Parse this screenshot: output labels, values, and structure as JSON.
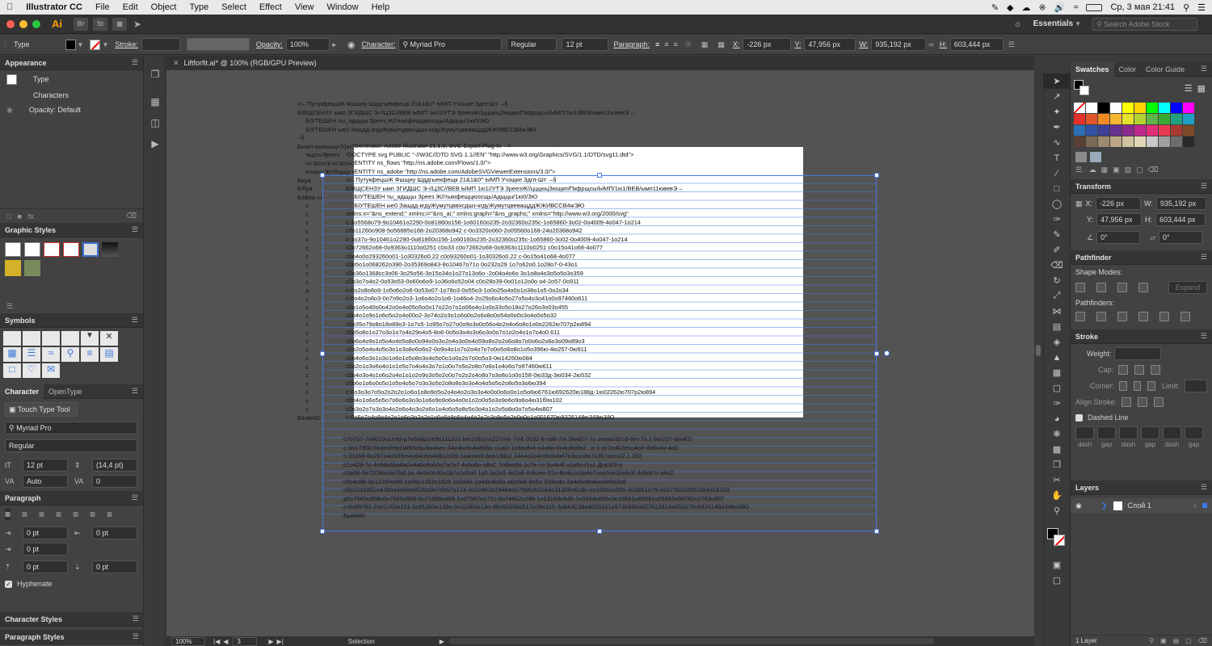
{
  "menubar": {
    "app_name": "Illustrator CC",
    "items": [
      "File",
      "Edit",
      "Object",
      "Type",
      "Select",
      "Effect",
      "View",
      "Window",
      "Help"
    ],
    "date_time": "Ср, 3 мая  21:41"
  },
  "appbar": {
    "ai_label": "Ai",
    "br_label": "Br",
    "st_label": "St",
    "workspace": "Essentials",
    "search_placeholder": "Search Adobe Stock"
  },
  "control": {
    "type_label": "Type",
    "stroke_label": "Stroke:",
    "opacity_label": "Opacity:",
    "opacity_value": "100%",
    "character_label": "Character:",
    "font": "Myriad Pro",
    "style": "Regular",
    "size": "12 pt",
    "paragraph_label": "Paragraph:",
    "x_label": "X:",
    "x_value": "-226 px",
    "y_label": "Y:",
    "y_value": "47,956 px",
    "w_label": "W:",
    "w_value": "935,192 px",
    "h_label": "H:",
    "h_value": "603,444 px"
  },
  "document": {
    "tab_title": "Liftforfit.ai* @ 100% (RGB/GPU Preview)",
    "zoom": "100%",
    "page": "3",
    "status": "Selection"
  },
  "appearance": {
    "title": "Appearance",
    "type_label": "Type",
    "characters_label": "Characters",
    "opacity_label": "Opacity: Default"
  },
  "graphic_styles": {
    "title": "Graphic Styles"
  },
  "symbols": {
    "title": "Symbols"
  },
  "character": {
    "tab_active": "Character",
    "tab_inactive": "OpenType",
    "touch_tool": "Touch Type Tool",
    "font": "Myriad Pro",
    "style": "Regular",
    "size": "12 pt",
    "leading": "(14,4 pt)",
    "kerning": "Auto",
    "tracking": "0"
  },
  "paragraph": {
    "title": "Paragraph",
    "indent_left": "0 pt",
    "indent_right": "0 pt",
    "first_line": "0 pt",
    "space_before": "0 pt",
    "space_after": "0 pt",
    "hyphenate": "Hyphenate"
  },
  "bottom_panels": {
    "character_styles": "Character Styles",
    "paragraph_styles": "Paragraph Styles"
  },
  "swatches": {
    "tabs": [
      "Swatches",
      "Color",
      "Color Guide"
    ],
    "colors": [
      "#ffffff",
      "#ffffff",
      "#000000",
      "#ffffff",
      "#ffff00",
      "#ffd400",
      "#00ff00",
      "#00ffff",
      "#0000ff",
      "#ff00ff",
      "#e4312b",
      "#e0562a",
      "#f08a22",
      "#f7b733",
      "#e6e22b",
      "#b4d334",
      "#5fb447",
      "#3aa935",
      "#20a07f",
      "#1fa0c3",
      "#2b6fb4",
      "#3253a5",
      "#3e3f96",
      "#673190",
      "#8b2c8d",
      "#c0278d",
      "#e22d78",
      "#e73a4e",
      "#a83a2f",
      "#7b4a26",
      "#5a4033",
      "#7a6a55",
      "#9c8a6f",
      "#b9a883",
      "#d2c3a0",
      "#e3d7b9",
      "#c9c9c9",
      "#a0a0a0",
      "#6e6e6e",
      "#2a2a2a"
    ]
  },
  "transform": {
    "title": "Transform",
    "x_label": "X:",
    "x_value": "-226 px",
    "y_label": "Y:",
    "y_value": "47,956 px",
    "w_label": "W:",
    "w_value": "935,192 px",
    "h_label": "H:",
    "h_value": "603,444 px",
    "rotate": "0°",
    "shear": "0°"
  },
  "pathfinder": {
    "title": "Pathfinder",
    "shape_modes": "Shape Modes:",
    "expand": "Expand",
    "pathfinders": "Pathfinders:"
  },
  "stroke": {
    "title": "Stroke",
    "weight_label": "Weight:",
    "cap_label": "Cap:",
    "corner_label": "Corner:",
    "limit_label": "Limit:",
    "align_label": "Align Stroke:",
    "dashed_line": "Dashed Line",
    "dash_labels": [
      "dash",
      "gap",
      "dash",
      "gap",
      "dash",
      "gap"
    ]
  },
  "layers": {
    "title": "Layers",
    "layer_name": "Слой 1",
    "count": "1 Layer"
  },
  "canvas_text": {
    "bg_lines": [
      "±!– ПутукфецшЖ Фшщну Шддгыекфещк 21&1&0^ ЫМП Учзщке Здгп-Шт  –§",
      "Б!ВЩСЕНЗУ ымп ЗГИДШС Э-//ЦЗС//ВЕВ ЫМП 1ю1//УТЭ ЗрееэЖ//цццюцЗющкп/Пкфрщсы/ЫМП/1ю1/ВЕВ/ымп11ювевЭ –",
      "     БIУТЕШЕН ты_адщцы Зреез Ж//тыюфещцюосщь/Адщцы/1ю0/ЗЮ",
      "     БIУТЕШЕН ые0 Зашдд-кгдуЖумутцввхсдшз-кгдуЖумутцвеващддЖЖИВССВ4жЭЮ",
      "~§",
      "Бымп мукышц=31ю1",
      "     чьдтыЭрееэ",
      "     ч=Э0эчЭ н=З0эчЭ шцквеЭ",
      "     кгыуы-Эутйщщу-кнЭ",
      "Беуа",
      "Б/буа",
      "Бэфер ы",
      "     с",
      "     с",
      "     с",
      "     с",
      "     с",
      "     с",
      "     с",
      "     с",
      "     с",
      "     с",
      "     д",
      "     с",
      "     с",
      "     с",
      "     с",
      "     с",
      "     с",
      "     с",
      "     с",
      "     с",
      "     с",
      "     с",
      "     с",
      "     с",
      "     с",
      "Б/ымпЮ"
    ],
    "art_lines": [
      "     Generator: Adobe Illustrator 21.1.0, SVG Export Plug-In  –>",
      "!DOCTYPE svg PUBLIC \"-//W3C//DTD SVG 1.1//EN\" \"http://www.w3.org/Graphics/SVG/1.1/DTD/svg11.dtd\">",
      "     ENTITY ns_flows \"http://ns.adobe.com/Flows/1.0/\">",
      "     ENTITY ns_adobe \"http://ns.adobe.com/AdobeSVGViewerExtensions/3.0/\">",
      "±!– ПутукфецшЖ Фшщну Шддгыекфещк 21&1&0^ ЫМП Учзщке Здгп-Шт  –§",
      "Б!ВЩСЕНЗУ ымп ЗГИДШС Э-//ЦЗС//ВЕВ ЫМП 1ю1//УТЭ ЗрееэЖ//цццюцЗющкп/Пкфрщсы/ЫМП/1ю1/ВЕВ/ымп11ювевЭ –",
      "     БIУТЕШЕН ты_адщцы Зреез Ж//тыюфещцюосщь/Адщцы/1ю0/ЗЮ",
      "     БIУТЕШЕН ые0 Зашдд-кгдуЖумутцввхсдшз-кгдуЖумутцвеващддЖЖИВССВ4жЭЮ",
      "xmlns:x=\"&ns_extend;\" xmlns:i=\"&ns_ai;\" xmlns:graph=\"&ns_graphs;\" xmlns=\"http://www.w3.org/2000/svg\"",
      "c-1o5568o79-9o10461o2290-0o81860o156-1o60160o235-2o32360o235c-1o65860-3o02-0o4009-4o047-1o214",
      "c0o11260o908-5o56885o168-2o20368o942 с-0o3320o060-2o05560o168-24o20368о942",
      "c-1o37o-9o10461o2290-0o818б0о156-1о60160о235-2о32360о235с-1о65860-3о02-0о4009-4о047-1о214",
      "c0o72662o68-0o9363o1110o0251 c0o33 с0о72662о68-0о9363о1110о0251 с0о15о41о68-4о077",
      "c0o4o0o293260o01-1o30326о0.22 с0о93260о01-1о30326о0.22 с-0о15о41о68-4о077",
      "c0o5o1o068262o390-2o35369o843-8o10467o71o 0о232о29 1о7о62о0.1о28о7-0-43о1",
      "c0o36o1368сс3о06-3о25о56-3о15о34о1о27о13о6о -2о04о4о6о 3о1о8о4о3о5о5о3о359",
      "c0o3о7о4о2-0о53о53-0о60о6о9-1о36о6о52о04 с0о28о39-0о01о12о0о о4-2о57-0о911",
      "c-0o2о8о6о9-1о5о6о2о6-0о53о07-1о78о3-0о55о3-1о0о25о4о0о1о38о1о5-0о2о34",
      "c-0o4о2о6о3-0о7о9о2о3-1о6о4о2о1о6-1о46о4-2о25о6о4о5о27о5о4о3о41о0о97460о611",
      "c0o1о5о40о0о42о0о4о05о5о0о17о22о7о1о06о4о1о0о33о5о18о27о26о3о03о455",
      "c0o4о1о9о1о6о5о2о4о00о2-3о74о2о3о1о6о0о2о6о8о0о54о0о0о3о4о0о5о32",
      "c0o35о79о8о18о89о3-1о7о5-1о95о7о27о0о9о3о0о56о4о2о4о6о8о1о0о2262ю707p2ю894",
      "c0o5о8о1о27о3о1о7о4о29о4о5-8о6-0о5о3о4о3о6о3о0о7о1о2о4о1о7о4о0.611",
      "c0o6о4о9о1о5о4о4о5о8о0о94о0о3о2о4о3о0о4о59о8о2о2о6о8о7о0о6о2о6о3о09о89о3",
      "c0o2о5о4о4о5о3о1о3о8о6о6о2-0о9о4о1о7о2о4о7о7о0о5о6о8о1о5о396ю-4ю257-0ю911",
      "c0o4о6о3о1о3о1о6о1о5о8о3о4о5о0о1о0о2о7о0о5о3-0ю14260ю084",
      "c0o2о1о3о6о4о1о1о5о7о4о4о3о7о1о0о7о5о2о8о7о6о1о4о6о7о97460ю611",
      "c0o4о3о4о1о6о2о4о1о1о2о9о3о5о2о0о7о2о2о4о8о7о3о8о1о0о158-0ю33д-3ю034-2ю532",
      "c0o6о1о6о0о5о1о5о4о5о7о3о3о5о2о8о8о3о3о4о4о5о5о2о8о5о3о6ю394",
      "c-0o3о3о7о5о2о2о2о1о6о1о8о9о5о2о4о4о2о3о3о4о0о0о6о0о1о5о6ю6761ю692620ю188д-1ю02262ю707р2ю894",
      "c0o4о1о6о5о5о7о6о6о3о3о1о6о9о9о6о4о0о1о2о0о5о3о9о6о9о6о4ю31бIю102",
      "c0o3о2о7о3о3о4о2о6о4о3о2о6о1о4о6о5о8о5о3о4о1о2о5о8о0о7о5о4ю807",
      "c-0о6о7о4о8о4о2о1о6о3о2о2о1о6о6о9о6о4о4о2о7о3о9о5о2о0о0о1о001670ю9326148ю348ю3/Ю"
    ],
    "sel_lines": [
      "c7o707-7o6610o1mtd-p7o6o6р1m9o1112o1 bm1081m1227m6-7m6 0032-8-nd8-7m 3lwd27-7o cwoao32o3-6m-7o.1-6m257-8m401",
      "c-0o17360-0o3m0Ho1Wb0o5o3w4wm-3Ao4io3o4o8б6o o1ai2-1o5oofo4-o4o8о-0o4o6o6в2 ..o-1 ol-2o4k2e1o4o0-4o6o4v-4o0",
      "c-3o268-6o267o4o5б9m4o94o5o4o8o2o30-1o4o4o0-6oo13do2 14o4o2o4m5ob4wl7o3o1o8o7v2b7ooo1i2.1.102",
      "c1o428-7o 4o9do5ba8a2o4o6o8ob0o7a7o7 4s6o6o o8oC 7o8oo9o 1o7e l o 5o4o4f o1o8o-l1o1 Дnp3/3-o",
      "c0o08-0o7209bo3o7fo0 bo 4o3o0o30o1b7o1o5o0 1o5 3o2o5 4o2o8 4nbzeo-51o-8o4o1o3o4o7ooo5ox3/o4o3l 4o9ot7o a4o2",
      "c0o4o9b-0o1226Ho85-1o06o1262o1526 1o2d48.1o4de4lo9o a6o0o8 9o5o 1l54o4o 2o4o5o8o4oo4o5o2o6",
      "c9o13160б1o4390o4o60o9б20o9o7d867o174-3o22463o29404o67566o53164o31309o619c-0o10561o005-0o3861o79-0o57762o29510o4316103",
      "д0o7660o908c0o7660o909-0o71965o459-1o27567o172c-0o74662o298-1o13163o546-1o0264o605c0o19561o85561o29663o00762o2763o807",
      "c-0o89761-2o01762o191-2o91363o139o-0o12360o13o-36o92656o517o39o115-3o843C98o4026101o9736830o027612810o001670o9326148o348o3/Ю",
      "БымпЮ"
    ]
  }
}
